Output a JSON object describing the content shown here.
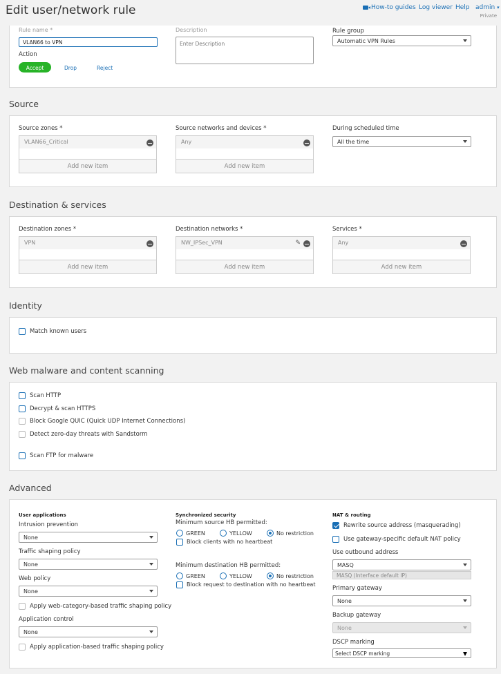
{
  "page": {
    "title": "Edit user/network rule"
  },
  "toplinks": {
    "howto": "How-to guides",
    "logviewer": "Log viewer",
    "help": "Help",
    "admin": "admin",
    "admin_sub": "Private"
  },
  "general": {
    "rule_name_label": "Rule name *",
    "rule_name_value": "VLAN66 to VPN",
    "action_label": "Action",
    "accept": "Accept",
    "drop": "Drop",
    "reject": "Reject",
    "description_label": "Description",
    "description_placeholder": "Enter Description",
    "rule_group_label": "Rule group",
    "rule_group_value": "Automatic VPN Rules"
  },
  "source": {
    "heading": "Source",
    "zones_label": "Source zones *",
    "zones_item": "VLAN66_Critical",
    "networks_label": "Source networks and devices *",
    "networks_item": "Any",
    "schedule_label": "During scheduled time",
    "schedule_value": "All the time",
    "add_new": "Add new item"
  },
  "destination": {
    "heading": "Destination & services",
    "zones_label": "Destination zones *",
    "zones_item": "VPN",
    "networks_label": "Destination networks *",
    "networks_item": "NW_IPSec_VPN",
    "services_label": "Services *",
    "services_item": "Any",
    "add_new": "Add new item"
  },
  "identity": {
    "heading": "Identity",
    "match_known": "Match known users"
  },
  "web": {
    "heading": "Web malware and content scanning",
    "scan_http": "Scan HTTP",
    "decrypt": "Decrypt & scan HTTPS",
    "quic": "Block Google QUIC (Quick UDP Internet Connections)",
    "zeroday": "Detect zero-day threats with Sandstorm",
    "ftp": "Scan FTP for malware"
  },
  "advanced": {
    "heading": "Advanced",
    "user_apps": "User applications",
    "ips_label": "Intrusion prevention",
    "ips_value": "None",
    "traffic_label": "Traffic shaping policy",
    "traffic_value": "None",
    "web_label": "Web policy",
    "web_value": "None",
    "web_shaping": "Apply web-category-based traffic shaping policy",
    "app_label": "Application control",
    "app_value": "None",
    "app_shaping": "Apply application-based traffic shaping policy",
    "sync": "Synchronized security",
    "min_src": "Minimum source HB permitted:",
    "green": "GREEN",
    "yellow": "YELLOW",
    "norestrict": "No restriction",
    "block_noheartbeat": "Block clients with no heartbeat",
    "min_dst": "Minimum destination HB permitted:",
    "block_dst": "Block request to destination with no heartbeat",
    "nat": "NAT & routing",
    "rewrite": "Rewrite source address (masquerading)",
    "gateway_nat": "Use gateway-specific default NAT policy",
    "outbound_label": "Use outbound address",
    "outbound_value": "MASQ",
    "outbound_sub": "MASQ (Interface default IP)",
    "primary_label": "Primary gateway",
    "primary_value": "None",
    "backup_label": "Backup gateway",
    "backup_value": "None",
    "dscp_label": "DSCP marking",
    "dscp_value": "Select DSCP marking"
  }
}
